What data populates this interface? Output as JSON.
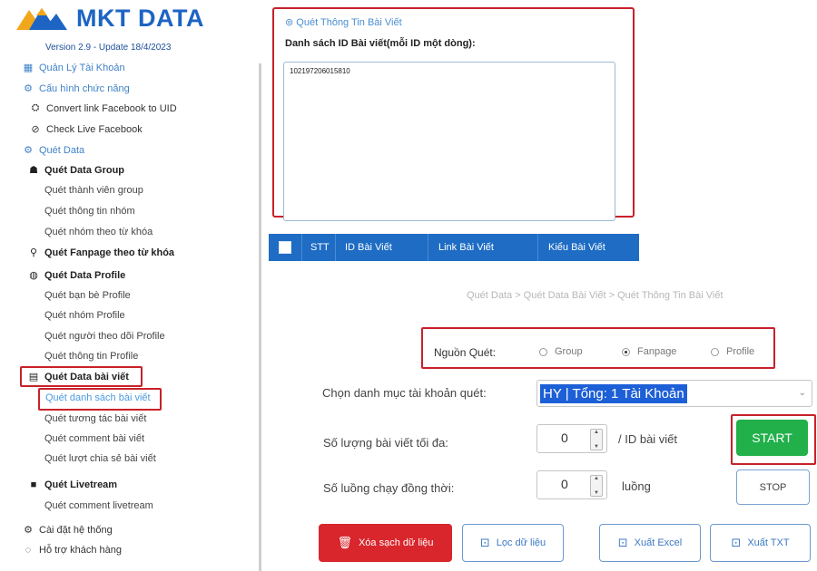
{
  "app": {
    "brand": "MKT DATA",
    "version": "Version 2.9 - Update 18/4/2023",
    "colors": {
      "primary": "#1d64c4",
      "danger": "#d8262c",
      "success": "#21b04a",
      "highlight": "#c82129"
    }
  },
  "sidebar": {
    "account": {
      "label": "Quản Lý Tài Khoản",
      "icon": "account-icon"
    },
    "config": {
      "label": "Cấu hình chức năng",
      "icon": "gear-icon"
    },
    "convert_link": {
      "label": "Convert link Facebook to UID",
      "icon": "link-icon"
    },
    "check_live": {
      "label": "Check Live Facebook",
      "icon": "check-circle-icon"
    },
    "scan_data": {
      "label": "Quét Data",
      "icon": "gear-icon"
    },
    "group": {
      "label": "Quét Data Group",
      "icon": "group-icon",
      "items": [
        "Quét thành viên group",
        "Quét thông tin nhóm",
        "Quét nhóm theo từ khóa"
      ]
    },
    "fanpage_keyword": {
      "label": "Quét Fanpage theo từ khóa",
      "icon": "search-icon"
    },
    "profile": {
      "label": "Quét Data Profile",
      "icon": "profile-icon",
      "items": [
        "Quét bạn bè Profile",
        "Quét nhóm Profile",
        "Quét người theo dõi Profile",
        "Quét thông tin Profile"
      ]
    },
    "posts": {
      "label": "Quét Data bài viết",
      "icon": "document-icon",
      "items": [
        "Quét danh sách bài viết",
        "Quét tương tác bài viết",
        "Quét comment bài viết",
        "Quét lượt chia sẻ bài viết"
      ]
    },
    "livestream": {
      "label": "Quét Livetream",
      "icon": "video-icon",
      "items": [
        "Quét comment livetream"
      ]
    },
    "settings": {
      "label": "Cài đặt hệ thống",
      "icon": "settings-icon"
    },
    "support": {
      "label": "Hỗ trợ khách hàng",
      "icon": "chat-icon"
    }
  },
  "post_info_panel": {
    "title": "Quét Thông Tin Bài Viết",
    "list_label": "Danh sách ID Bài viết(mỗi ID một dòng):",
    "ids_value": "102197206015810"
  },
  "table": {
    "columns": [
      "STT",
      "ID Bài Viết",
      "Link Bài Viết",
      "Kiểu Bài Viết"
    ]
  },
  "main": {
    "breadcrumb": "Quét Data > Quét Data Bài Viết > Quét Thông Tin Bài Viết",
    "source": {
      "label": "Nguồn Quét:",
      "options": [
        "Group",
        "Fanpage",
        "Profile"
      ],
      "selected": "Fanpage"
    },
    "account_category": {
      "label": "Chọn danh mục tài khoản quét:",
      "value": "HY | Tổng: 1 Tài Khoản"
    },
    "max_posts": {
      "label": "Số lượng bài viết tối đa:",
      "value": "0",
      "unit": "/ ID bài viết"
    },
    "threads": {
      "label": "Số luồng chạy đồng thời:",
      "value": "0",
      "unit": "luồng"
    },
    "buttons": {
      "start": "START",
      "stop": "STOP",
      "clear": "Xóa sạch dữ liệu",
      "filter": "Lọc dữ liệu",
      "export_excel": "Xuất Excel",
      "export_txt": "Xuất TXT"
    }
  }
}
